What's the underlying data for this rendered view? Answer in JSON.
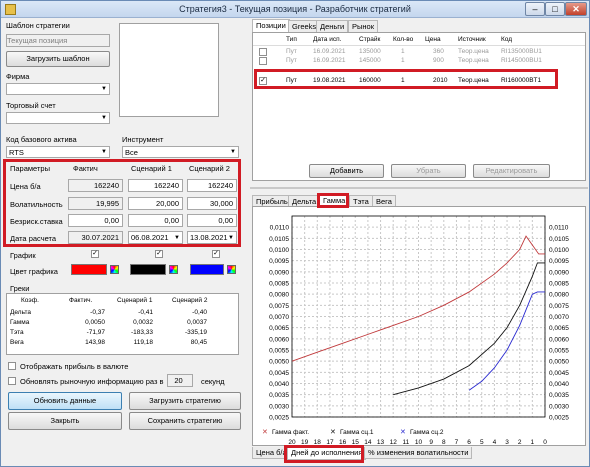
{
  "window": {
    "title": "Стратегия3 - Текущая позиция - Разработчик стратегий",
    "min": "–",
    "max": "□",
    "close": "✕"
  },
  "left": {
    "template_label": "Шаблон стратегии",
    "template_value": "Текущая позиция",
    "load_template": "Загрузить шаблон",
    "firm_label": "Фирма",
    "account_label": "Торговый счет",
    "base_label": "Код базового актива",
    "base_value": "RTS",
    "instrument_label": "Инструмент",
    "instrument_value": "Все"
  },
  "params": {
    "headers": [
      "Параметры",
      "Фактич",
      "Сценарий 1",
      "Сценарий 2"
    ],
    "rows": [
      {
        "label": "Цена б/а",
        "fact": "162240",
        "s1": "162240",
        "s2": "162240"
      },
      {
        "label": "Волатильность",
        "fact": "19,995",
        "s1": "20,000",
        "s2": "30,000"
      },
      {
        "label": "Безриск.ставка",
        "fact": "0,00",
        "s1": "0,00",
        "s2": "0,00"
      },
      {
        "label": "Дата расчета",
        "fact": "30.07.2021",
        "s1": "06.08.2021",
        "s2": "13.08.2021"
      }
    ],
    "chart_label": "График",
    "color_label": "Цвет графика",
    "colors": [
      "#ff0000",
      "#000000",
      "#0000ff"
    ]
  },
  "greeks": {
    "title": "Греки",
    "headers": [
      "Коэф.",
      "Фактич.",
      "Сценарий 1",
      "Сценарий 2"
    ],
    "rows": [
      [
        "Дельта",
        "-0,37",
        "-0,41",
        "-0,40"
      ],
      [
        "Гамма",
        "0,0050",
        "0,0032",
        "0,0037"
      ],
      [
        "Тэта",
        "-71,97",
        "-183,33",
        "-335,19"
      ],
      [
        "Вега",
        "143,98",
        "119,18",
        "80,45"
      ]
    ]
  },
  "options": {
    "show_profit": "Отображать прибыль в валюте",
    "update_market": "Обновлять рыночную информацию раз в",
    "interval": "20",
    "seconds": "секунд"
  },
  "buttons": {
    "refresh": "Обновить данные",
    "load_strategy": "Загрузить стратегию",
    "close": "Закрыть",
    "save_strategy": "Сохранить стратегию"
  },
  "top_tabs": [
    "Позиции",
    "Greeks",
    "Деньги",
    "Рынок"
  ],
  "positions": {
    "headers": [
      "Тип",
      "Дата исп.",
      "Страйк",
      "Кол-во",
      "Цена",
      "Источник",
      "Код"
    ],
    "rows": [
      {
        "checked": false,
        "type": "Пут",
        "date": "16.09.2021",
        "strike": "135000",
        "qty": "1",
        "price": "360",
        "source": "Теор.цена",
        "code": "RI135000BU1",
        "dim": true
      },
      {
        "checked": false,
        "type": "Пут",
        "date": "16.09.2021",
        "strike": "145000",
        "qty": "1",
        "price": "900",
        "source": "Теор.цена",
        "code": "RI145000BU1",
        "dim": true
      },
      {
        "checked": false,
        "type": "",
        "date": "",
        "strike": "",
        "qty": "",
        "price": "",
        "source": "",
        "code": "",
        "dim": true
      },
      {
        "checked": true,
        "type": "Пут",
        "date": "19.08.2021",
        "strike": "160000",
        "qty": "1",
        "price": "2010",
        "source": "Теор.цена",
        "code": "RI160000BT1",
        "dim": false
      }
    ],
    "add": "Добавить",
    "remove": "Убрать",
    "edit": "Редактировать"
  },
  "chart_tabs": [
    "Прибыль",
    "Дельта",
    "Гамма",
    "Тэта",
    "Вега"
  ],
  "bottom_tabs": [
    "Цена б/а",
    "Дней до исполнения",
    "% изменения волатильности"
  ],
  "chart_data": {
    "type": "line",
    "ylim": [
      0.0025,
      0.0115
    ],
    "y_ticks": [
      "0,0110",
      "0,0105",
      "0,0100",
      "0,0095",
      "0,0090",
      "0,0085",
      "0,0080",
      "0,0075",
      "0,0070",
      "0,0065",
      "0,0060",
      "0,0055",
      "0,0050",
      "0,0045",
      "0,0040",
      "0,0035",
      "0,0030",
      "0,0025"
    ],
    "x_ticks": [
      "20",
      "19",
      "18",
      "17",
      "16",
      "15",
      "14",
      "13",
      "12",
      "11",
      "10",
      "9",
      "8",
      "7",
      "6",
      "5",
      "4",
      "3",
      "2",
      "1",
      "0"
    ],
    "series": [
      {
        "name": "Гамма факт.",
        "color": "#c0393b",
        "x": [
          20,
          18,
          16,
          14,
          12,
          10,
          8,
          6,
          4,
          3,
          2,
          1.5,
          1,
          0.5,
          0
        ],
        "y": [
          0.005,
          0.0054,
          0.0058,
          0.0062,
          0.0066,
          0.007,
          0.0075,
          0.0081,
          0.0089,
          0.0094,
          0.01,
          0.0106,
          0.0102,
          0.0098,
          0.0098
        ]
      },
      {
        "name": "Гамма сц.1",
        "color": "#111111",
        "x": [
          12,
          10,
          8,
          6,
          4,
          3,
          2,
          1,
          0.6,
          0.3,
          0
        ],
        "y": [
          0.0035,
          0.0038,
          0.0042,
          0.0048,
          0.0058,
          0.0065,
          0.0075,
          0.0088,
          0.0094,
          0.0094,
          0.0094
        ]
      },
      {
        "name": "Гамма сц.2",
        "color": "#2a2ad0",
        "x": [
          6,
          5,
          4,
          3,
          2,
          1.5,
          1,
          0.6,
          0.3,
          0
        ],
        "y": [
          0.0037,
          0.0041,
          0.0047,
          0.0055,
          0.0066,
          0.0073,
          0.008,
          0.0081,
          0.0081,
          0.0081
        ]
      }
    ]
  }
}
